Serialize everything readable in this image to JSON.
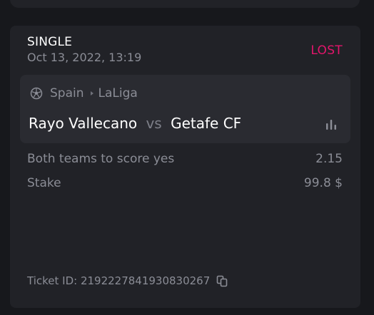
{
  "bet": {
    "type": "SINGLE",
    "date": "Oct 13, 2022, 13:19",
    "status": "LOST",
    "status_color": "#e2156b"
  },
  "event": {
    "sport_icon": "soccer-ball-icon",
    "country": "Spain",
    "league": "LaLiga",
    "home_team": "Rayo Vallecano",
    "vs": "vs",
    "away_team": "Getafe CF",
    "stats_icon": "bar-chart-icon"
  },
  "selection": {
    "market": "Both teams to score yes",
    "odds": "2.15"
  },
  "stake": {
    "label": "Stake",
    "value": "99.8 $"
  },
  "ticket": {
    "label": "Ticket ID: 2192227841930830267",
    "copy_icon": "copy-icon"
  }
}
